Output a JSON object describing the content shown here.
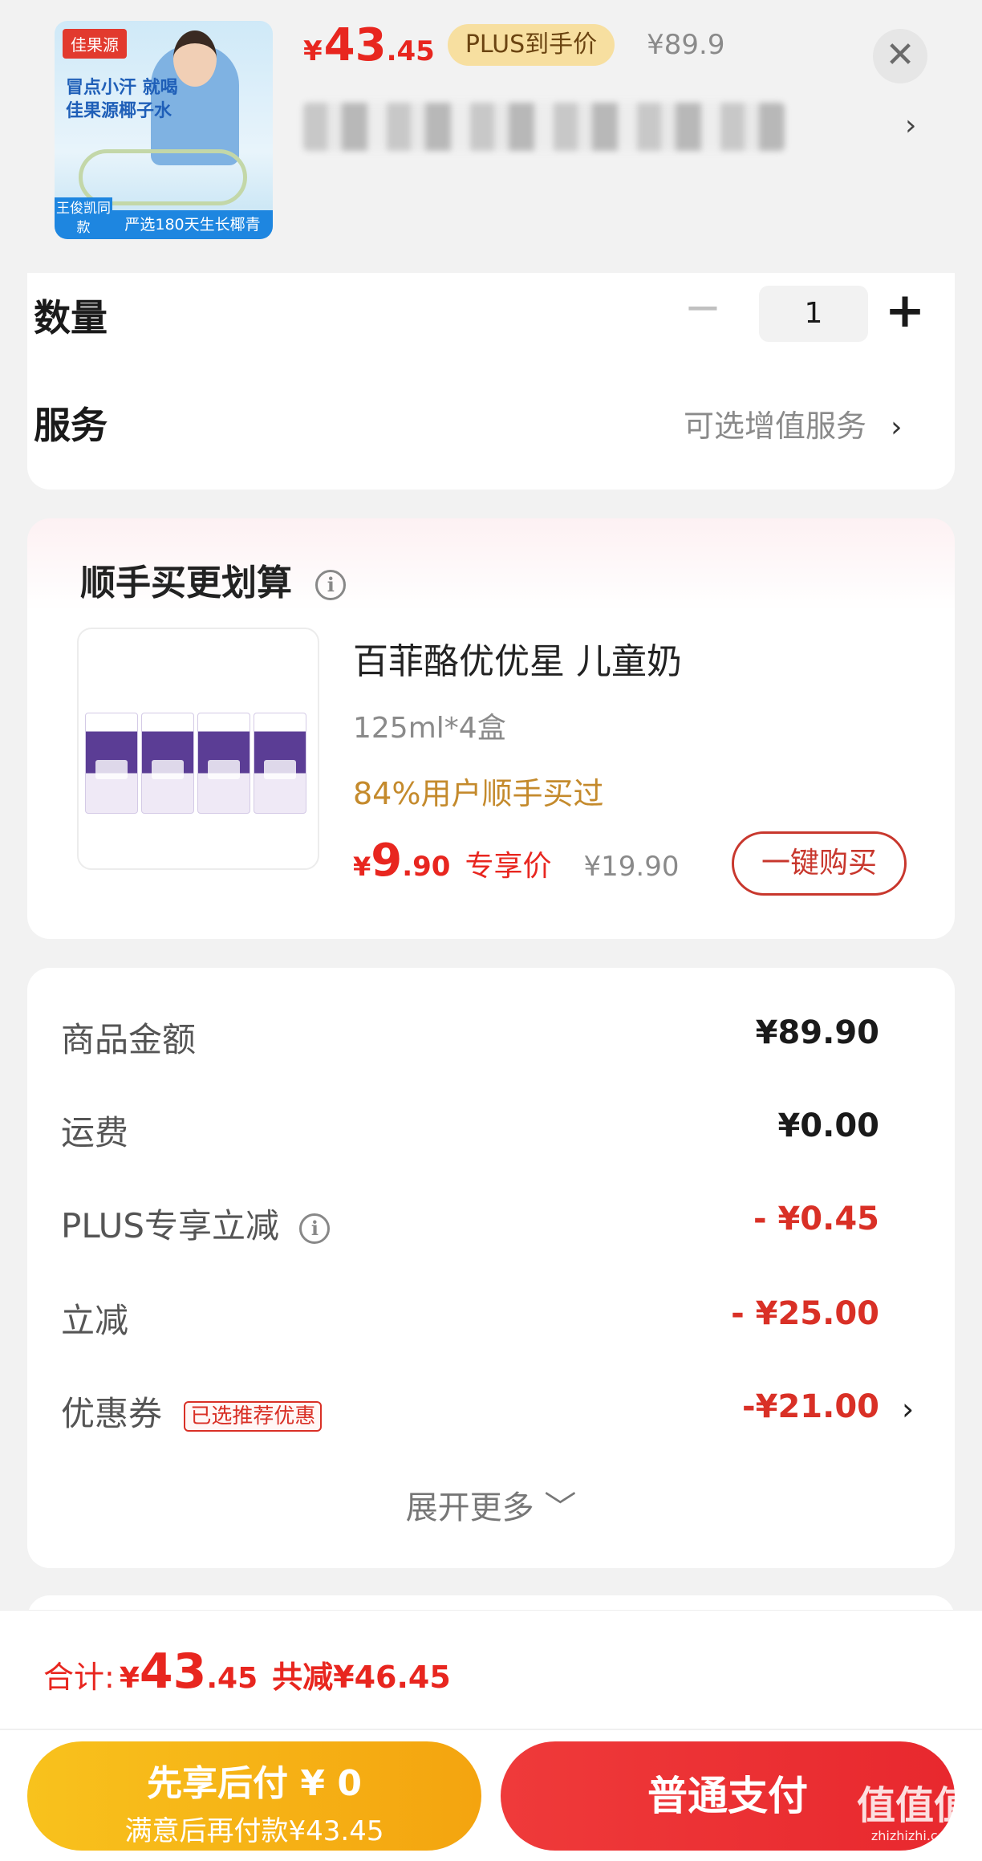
{
  "header": {
    "image": {
      "brand": "佳果源",
      "slogan": "冒点小汗 就喝佳果源椰子水",
      "tag_left": "王俊凯同款",
      "tag_right": "严选180天生长椰青"
    },
    "price": {
      "yen": "¥",
      "int": "43",
      "dec": ".45"
    },
    "plus_badge": "PLUS到手价",
    "original_price": "¥89.9",
    "close_icon": "✕",
    "spec_chevron": "›"
  },
  "quantity": {
    "label": "数量",
    "minus": "−",
    "value": "1",
    "plus": "+"
  },
  "service": {
    "label": "服务",
    "link": "可选增值服务",
    "chevron": "›"
  },
  "upsell": {
    "title": "顺手买更划算",
    "info_icon": "i",
    "name": "百菲酪优优星 儿童奶",
    "spec": "125ml*4盒",
    "social": "84%用户顺手买过",
    "price": {
      "yen": "¥",
      "int": "9",
      "dec": ".90"
    },
    "exclusive": "专享价",
    "original": "¥19.90",
    "buy_button": "一键购买"
  },
  "summary": {
    "rows": [
      {
        "label": "商品金额",
        "value": "¥89.90"
      },
      {
        "label": "运费",
        "value": "¥0.00"
      },
      {
        "label": "PLUS专享立减",
        "value": "- ¥0.45"
      },
      {
        "label": "立减",
        "value": "- ¥25.00"
      },
      {
        "label": "优惠券",
        "tag": "已选推荐优惠",
        "value": "-¥21.00"
      }
    ],
    "info_icon": "i",
    "coupon_chevron": "›",
    "expand": "展开更多 ﹀"
  },
  "footer": {
    "total_label": "合计:",
    "total": {
      "yen": "¥",
      "int": "43",
      "dec": ".45"
    },
    "savings": "共减¥46.45",
    "pay_later": {
      "line1": "先享后付 ¥ 0",
      "line2": "满意后再付款¥43.45"
    },
    "pay_normal": "普通支付"
  },
  "watermark": {
    "text": "值值值",
    "url": "zhizhizhi.com"
  },
  "colors": {
    "accent_red": "#e8261f",
    "plus_gold": "#f7dfa0",
    "pay_yellow": "#f8c21d",
    "social_gold": "#c48a2c"
  }
}
